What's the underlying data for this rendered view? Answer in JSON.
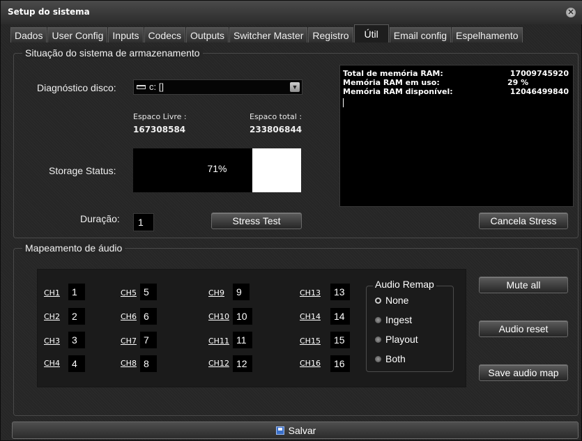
{
  "window": {
    "title": "Setup do sistema"
  },
  "tabs": [
    {
      "label": "Dados"
    },
    {
      "label": "User Config"
    },
    {
      "label": "Inputs"
    },
    {
      "label": "Codecs"
    },
    {
      "label": "Outputs"
    },
    {
      "label": "Switcher Master"
    },
    {
      "label": "Registro"
    },
    {
      "label": "Útil",
      "active": true
    },
    {
      "label": "Email config"
    },
    {
      "label": "Espelhamento"
    }
  ],
  "storage": {
    "group_title": "Situação do sistema de armazenamento",
    "disk_label": "Diagnóstico disco:",
    "disk_value": "c: []",
    "free_label": "Espaco Livre :",
    "free_value": "167308584",
    "total_label": "Espaco total :",
    "total_value": "233806844",
    "status_label": "Storage Status:",
    "status_percent": 71,
    "status_text": "71%",
    "duration_label": "Duração:",
    "duration_value": "1",
    "stress_button": "Stress Test",
    "cancel_button": "Cancela Stress"
  },
  "ram": {
    "rows": [
      {
        "label": "Total de memória RAM:",
        "value": "17009745920"
      },
      {
        "label": "Memória RAM em uso:",
        "value": "29 %"
      },
      {
        "label": "Memória RAM disponível:",
        "value": "12046499840"
      }
    ]
  },
  "audio": {
    "group_title": "Mapeamento de áudio",
    "channels": [
      {
        "label": "CH1",
        "value": "1"
      },
      {
        "label": "CH2",
        "value": "2"
      },
      {
        "label": "CH3",
        "value": "3"
      },
      {
        "label": "CH4",
        "value": "4"
      },
      {
        "label": "CH5",
        "value": "5"
      },
      {
        "label": "CH6",
        "value": "6"
      },
      {
        "label": "CH7",
        "value": "7"
      },
      {
        "label": "CH8",
        "value": "8"
      },
      {
        "label": "CH9",
        "value": "9"
      },
      {
        "label": "CH10",
        "value": "10"
      },
      {
        "label": "CH11",
        "value": "11"
      },
      {
        "label": "CH12",
        "value": "12"
      },
      {
        "label": "CH13",
        "value": "13"
      },
      {
        "label": "CH14",
        "value": "14"
      },
      {
        "label": "CH15",
        "value": "15"
      },
      {
        "label": "CH16",
        "value": "16"
      }
    ],
    "remap_title": "Audio Remap",
    "remap_options": [
      {
        "label": "None",
        "selected": true
      },
      {
        "label": "Ingest",
        "selected": false
      },
      {
        "label": "Playout",
        "selected": false
      },
      {
        "label": "Both",
        "selected": false
      }
    ],
    "mute_button": "Mute all",
    "reset_button": "Audio reset",
    "save_map_button": "Save audio map"
  },
  "footer": {
    "save_label": "Salvar"
  },
  "colors": {
    "background": "#262626",
    "field": "#000000",
    "button": "#3a3a3a"
  }
}
